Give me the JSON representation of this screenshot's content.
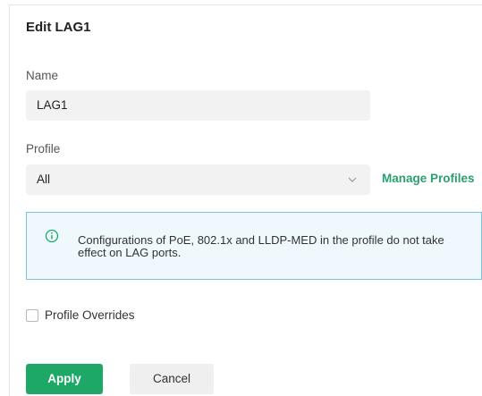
{
  "dialog": {
    "title": "Edit LAG1"
  },
  "name_field": {
    "label": "Name",
    "value": "LAG1"
  },
  "profile_field": {
    "label": "Profile",
    "value": "All",
    "manage_link": "Manage Profiles"
  },
  "notice": {
    "icon": "info-circle-icon",
    "text": "Configurations of PoE, 802.1x and LLDP-MED in the profile do not take effect on LAG ports."
  },
  "overrides": {
    "label": "Profile Overrides",
    "checked": false
  },
  "buttons": {
    "apply": "Apply",
    "cancel": "Cancel"
  },
  "colors": {
    "accent": "#1ea868",
    "link": "#2aa06f",
    "notice_border": "#7fc4e6",
    "notice_bg": "#eef8fd",
    "info_icon": "#1ea868"
  }
}
